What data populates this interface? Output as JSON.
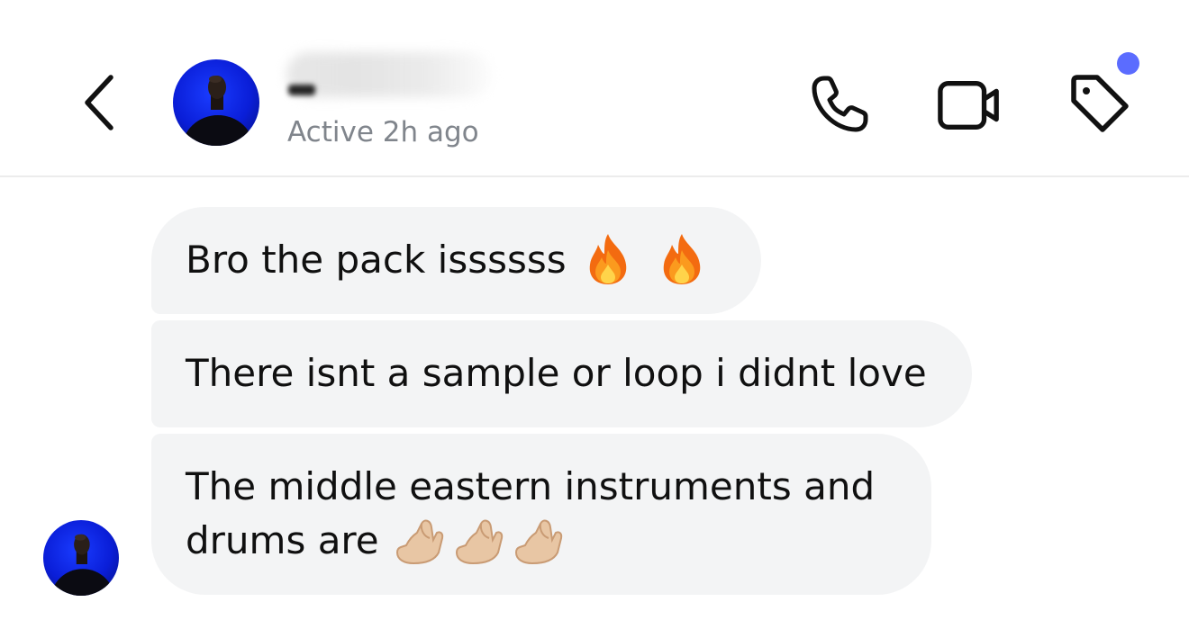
{
  "header": {
    "contact_name": "",
    "status": "Active 2h ago",
    "icons": {
      "back": "chevron-left-icon",
      "call": "phone-icon",
      "video": "video-camera-icon",
      "tag": "tag-icon"
    },
    "notification_dot_color": "#5b6cff"
  },
  "messages": [
    {
      "text": "Bro the pack issssss",
      "emojis": [
        "fire",
        "fire"
      ]
    },
    {
      "text": "There isnt a sample or loop i didnt love",
      "emojis": []
    },
    {
      "line1": "The middle eastern instruments and",
      "line2": "drums are",
      "emojis": [
        "pinched-fingers",
        "pinched-fingers",
        "pinched-fingers"
      ]
    }
  ],
  "colors": {
    "bubble_background": "#f3f4f5",
    "status_text": "#80858c",
    "avatar_background": "#0a1ed8"
  }
}
